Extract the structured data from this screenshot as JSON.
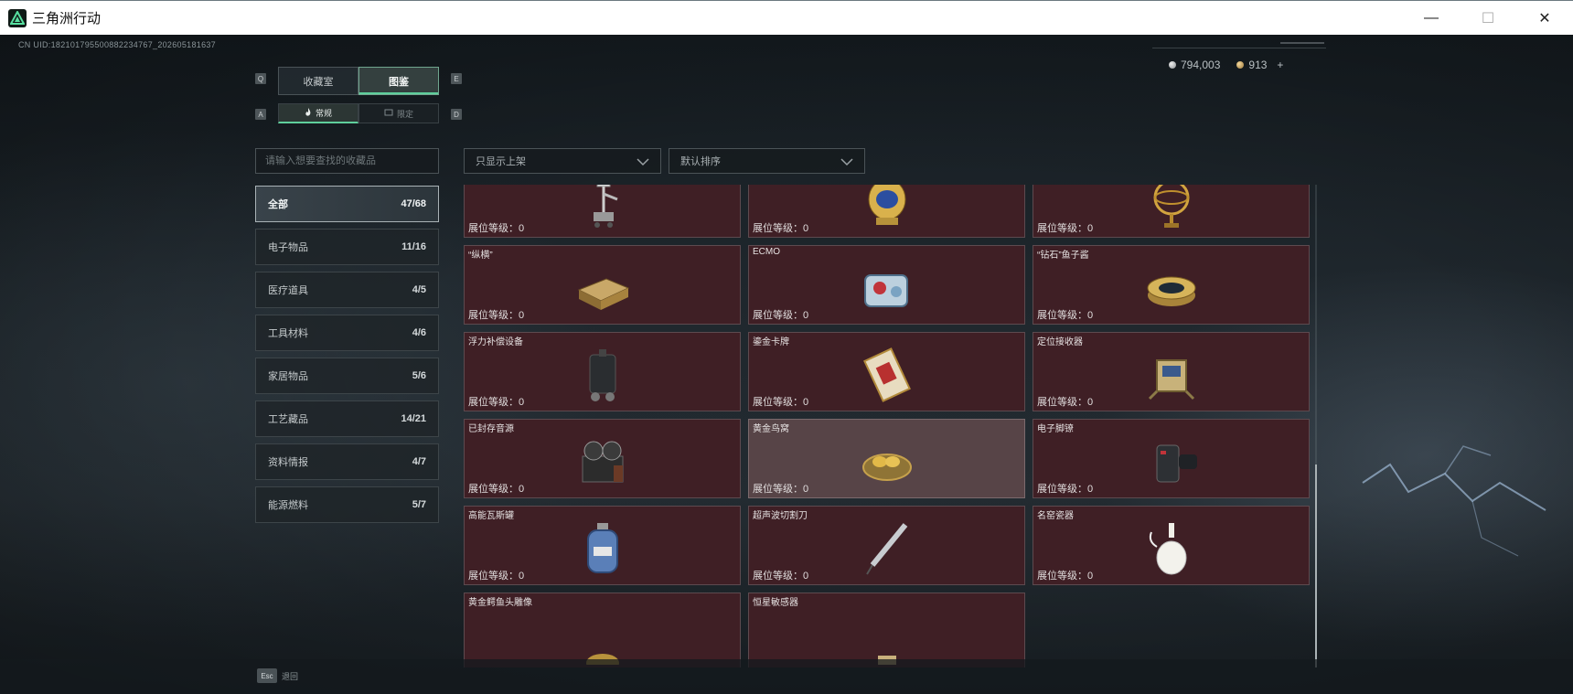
{
  "window": {
    "title": "三角洲行动",
    "minimize": "—",
    "maximize": "☐",
    "close": "✕"
  },
  "uid": "CN UID:1821017955008822347​67_202605181637",
  "currency": {
    "silver": "794,003",
    "gold": "913",
    "add": "+"
  },
  "keys": {
    "tab_left": "Q",
    "tab_right": "E",
    "sub_left": "A",
    "sub_right": "D"
  },
  "tabs": [
    {
      "label": "收藏室"
    },
    {
      "label": "图鉴"
    }
  ],
  "subtabs": [
    {
      "label": "常规"
    },
    {
      "label": "限定"
    }
  ],
  "search": {
    "placeholder": "请输入想要查找的收藏品"
  },
  "filters": {
    "show": "只显示上架",
    "sort": "默认排序"
  },
  "categories": [
    {
      "label": "全部",
      "count": "47/68"
    },
    {
      "label": "电子物品",
      "count": "11/16"
    },
    {
      "label": "医疗道具",
      "count": "4/5"
    },
    {
      "label": "工具材料",
      "count": "4/6"
    },
    {
      "label": "家居物品",
      "count": "5/6"
    },
    {
      "label": "工艺藏品",
      "count": "14/21"
    },
    {
      "label": "资料情报",
      "count": "4/7"
    },
    {
      "label": "能源燃料",
      "count": "5/7"
    }
  ],
  "items": [
    {
      "name": "",
      "level": "展位等级：0",
      "icon": "robot-arm-icon"
    },
    {
      "name": "",
      "level": "展位等级：0",
      "icon": "jeweled-egg-icon"
    },
    {
      "name": "",
      "level": "展位等级：0",
      "icon": "armillary-sphere-icon"
    },
    {
      "name": "“纵横”",
      "level": "展位等级：0",
      "icon": "chess-box-icon"
    },
    {
      "name": "ECMO",
      "level": "展位等级：0",
      "icon": "ecmo-machine-icon"
    },
    {
      "name": "“钻石”鱼子酱",
      "level": "展位等级：0",
      "icon": "caviar-tin-icon"
    },
    {
      "name": "浮力补偿设备",
      "level": "展位等级：0",
      "icon": "buoyancy-device-icon"
    },
    {
      "name": "鎏金卡牌",
      "level": "展位等级：0",
      "icon": "gilded-card-icon"
    },
    {
      "name": "定位接收器",
      "level": "展位等级：0",
      "icon": "gps-receiver-icon"
    },
    {
      "name": "已封存音源",
      "level": "展位等级：0",
      "icon": "reel-recorder-icon"
    },
    {
      "name": "黄金鸟窝",
      "level": "展位等级：0",
      "icon": "golden-nest-icon"
    },
    {
      "name": "电子脚镣",
      "level": "展位等级：0",
      "icon": "ankle-monitor-icon"
    },
    {
      "name": "高能瓦斯罐",
      "level": "展位等级：0",
      "icon": "gas-cylinder-icon"
    },
    {
      "name": "超声波切割刀",
      "level": "展位等级：0",
      "icon": "ultrasonic-knife-icon"
    },
    {
      "name": "名窑瓷器",
      "level": "展位等级：0",
      "icon": "porcelain-vase-icon"
    },
    {
      "name": "黄金鳄鱼头雕像",
      "level": "",
      "icon": "croc-statue-icon"
    },
    {
      "name": "恒星敏感器",
      "level": "",
      "icon": "star-sensor-icon"
    }
  ],
  "esc": {
    "key": "Esc",
    "label": "退回"
  }
}
